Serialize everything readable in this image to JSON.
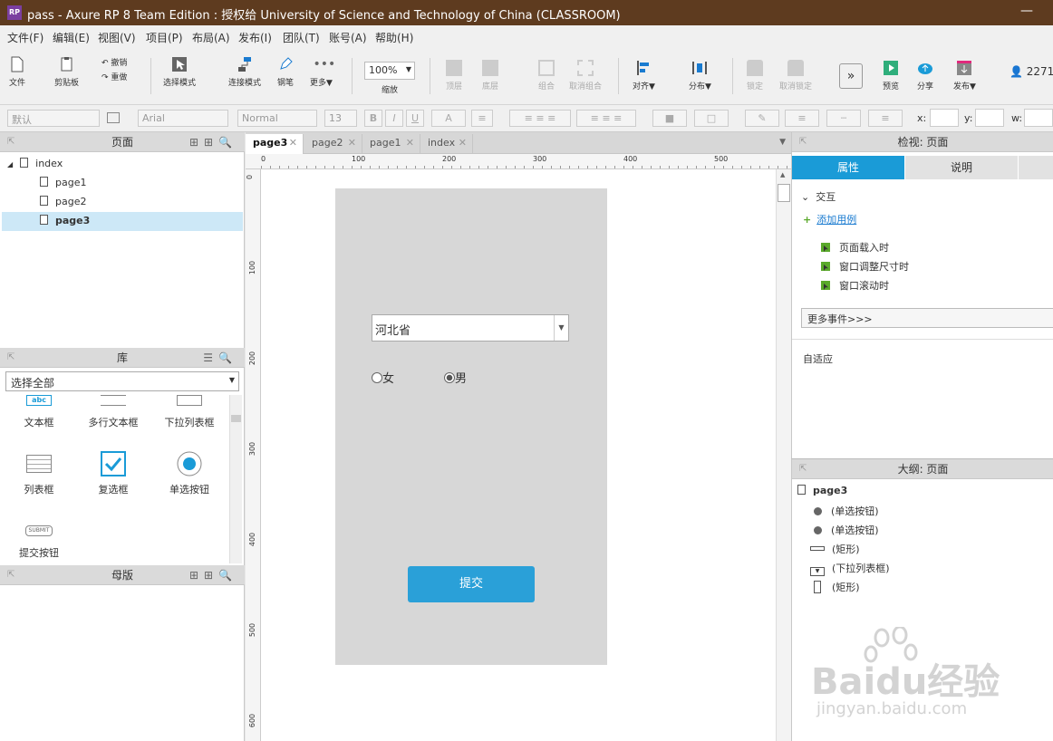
{
  "window": {
    "app_icon": "RP",
    "title": "pass - Axure RP 8 Team Edition : 授权给 University of Science and Technology of China (CLASSROOM)",
    "minimize": "—"
  },
  "menu": [
    "文件(F)",
    "编辑(E)",
    "视图(V)",
    "项目(P)",
    "布局(A)",
    "发布(I)",
    "团队(T)",
    "账号(A)",
    "帮助(H)"
  ],
  "toolbar": {
    "file": "文件",
    "clipboard": "剪贴板",
    "undo": "撤销",
    "redo": "重做",
    "select_mode": "选择模式",
    "connect_mode": "连接模式",
    "pen": "钢笔",
    "more": "更多▼",
    "zoom_value": "100%",
    "zoom": "缩放",
    "top": "顶层",
    "bottom": "底层",
    "group": "组合",
    "ungroup": "取消组合",
    "align": "对齐▼",
    "distribute": "分布▼",
    "lock": "锁定",
    "unlock": "取消锁定",
    "preview": "预览",
    "share": "分享",
    "publish": "发布▼",
    "user": "2271"
  },
  "format": {
    "style": "默认",
    "font": "Arial",
    "weight": "Normal",
    "size": "13",
    "x_label": "x:",
    "y_label": "y:",
    "w_label": "w:"
  },
  "pages_panel": {
    "title": "页面",
    "items": [
      "index",
      "page1",
      "page2",
      "page3"
    ],
    "selected": "page3"
  },
  "library_panel": {
    "title": "库",
    "filter": "选择全部",
    "items": [
      "文本框",
      "多行文本框",
      "下拉列表框",
      "列表框",
      "复选框",
      "单选按钮",
      "提交按钮"
    ],
    "submit_icon_text": "SUBMIT",
    "textbox_icon_text": "abc"
  },
  "masters_panel": {
    "title": "母版"
  },
  "tabs": [
    "page3",
    "page2",
    "page1",
    "index"
  ],
  "active_tab": "page3",
  "rulers": {
    "top": [
      "0",
      "100",
      "200",
      "300",
      "400",
      "500"
    ],
    "left": [
      "0",
      "100",
      "200",
      "300",
      "400",
      "500",
      "600"
    ]
  },
  "canvas": {
    "select_value": "河北省",
    "radio_female": "女",
    "radio_male": "男",
    "male_selected": true,
    "submit_label": "提交"
  },
  "inspector": {
    "title": "检视: 页面",
    "tab_properties": "属性",
    "tab_notes": "说明",
    "section_interaction": "交互",
    "add_case": "添加用例",
    "events": [
      "页面载入时",
      "窗口调整尺寸时",
      "窗口滚动时"
    ],
    "more_events": "更多事件>>>",
    "adaptive": "自适应"
  },
  "outline": {
    "title": "大纲: 页面",
    "root": "page3",
    "items": [
      "(单选按钮)",
      "(单选按钮)",
      "(矩形)",
      "(下拉列表框)",
      "(矩形)"
    ]
  },
  "watermark": {
    "brand": "Baidu经验",
    "url": "jingyan.baidu.com"
  },
  "colors": {
    "titlebar": "#5e3b1f",
    "accent": "#1a9bd7",
    "selection": "#cde8f7",
    "submit": "#2aa0d8",
    "phone_bg": "#d7d7d7"
  }
}
